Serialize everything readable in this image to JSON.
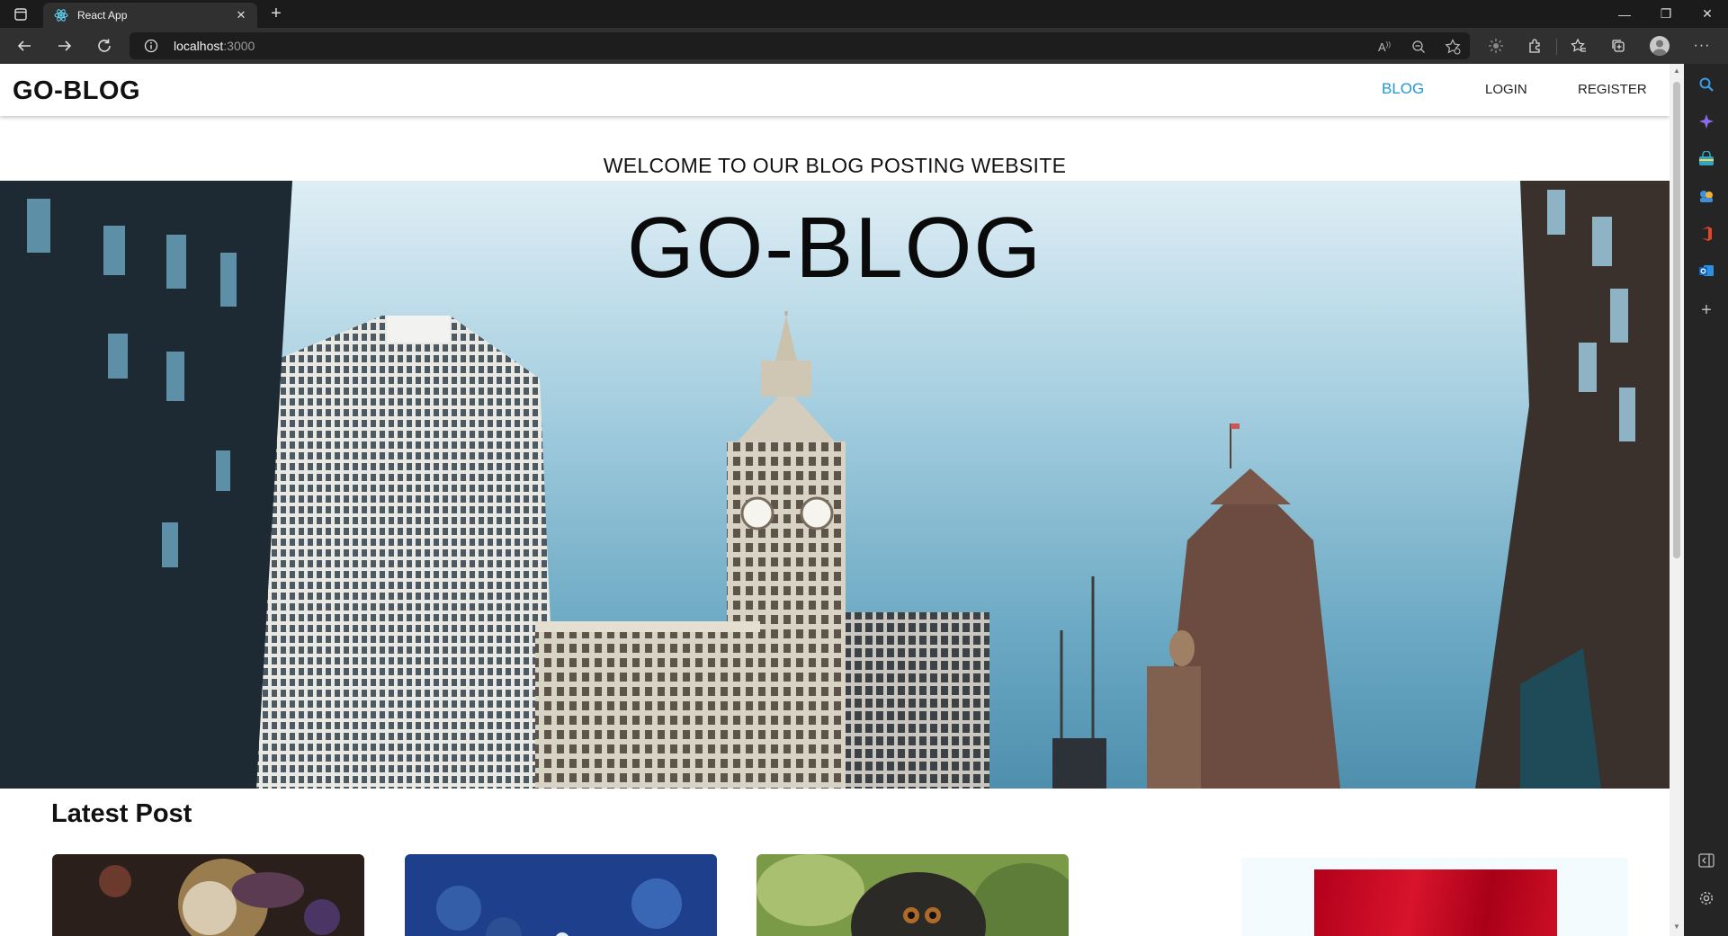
{
  "browser": {
    "tab_title": "React App",
    "tab_close": "✕",
    "new_tab": "+",
    "url_host": "localhost",
    "url_port": ":3000",
    "window_controls": {
      "minimize": "—",
      "restore": "❐",
      "close": "✕"
    },
    "more_menu": "···"
  },
  "site": {
    "logo": "GO-BLOG",
    "nav": [
      {
        "label": "BLOG",
        "active": true
      },
      {
        "label": "LOGIN",
        "active": false
      },
      {
        "label": "REGISTER",
        "active": false
      }
    ],
    "welcome": "WELCOME TO OUR BLOG POSTING WEBSITE",
    "hero_title": "GO-BLOG",
    "latest_heading": "Latest Post"
  },
  "colors": {
    "nav_active": "#2196d8",
    "chrome_dark": "#1b1b1b",
    "toolbar": "#303030"
  }
}
